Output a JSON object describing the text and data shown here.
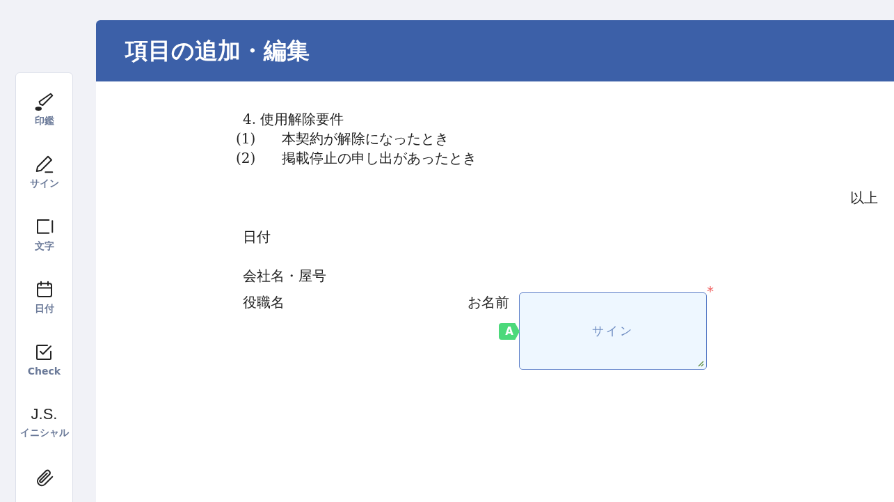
{
  "header": {
    "title": "項目の追加・編集"
  },
  "sidebar": {
    "items": [
      {
        "kind": "stamp",
        "label": "印鑑"
      },
      {
        "kind": "sign",
        "label": "サイン"
      },
      {
        "kind": "text",
        "label": "文字"
      },
      {
        "kind": "date",
        "label": "日付"
      },
      {
        "kind": "check",
        "label": "Check"
      },
      {
        "kind": "initial",
        "mark": "J.S.",
        "label": "イニシャル"
      },
      {
        "kind": "attach"
      }
    ]
  },
  "document": {
    "section": "4. 使用解除要件",
    "items": [
      {
        "number": "(1)",
        "text": "本契約が解除になったとき"
      },
      {
        "number": "(2)",
        "text": "掲載停止の申し出があったとき"
      }
    ],
    "closing": "以上",
    "fields": [
      {
        "label": "日付"
      },
      {
        "label": "会社名・屋号"
      },
      {
        "label": "役職名",
        "label_2": "お名前"
      }
    ],
    "sign_field": {
      "placeholder": "サイン",
      "signer": "A",
      "required_mark": "*"
    }
  }
}
